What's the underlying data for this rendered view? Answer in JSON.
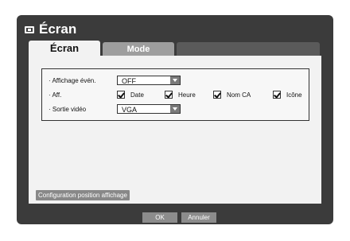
{
  "window": {
    "title": "Écran",
    "title_icon": "screen-icon"
  },
  "tabs": [
    {
      "label": "Écran",
      "active": true
    },
    {
      "label": "Mode",
      "active": false
    }
  ],
  "settings": {
    "event_display": {
      "label": "· Affichage évén.",
      "value": "OFF"
    },
    "display": {
      "label": "· Aff.",
      "options": [
        {
          "label": "Date",
          "checked": true
        },
        {
          "label": "Heure",
          "checked": true
        },
        {
          "label": "Nom CA",
          "checked": true
        },
        {
          "label": "Icône",
          "checked": true
        }
      ]
    },
    "video_output": {
      "label": "· Sortie vidéo",
      "value": "VGA"
    }
  },
  "buttons": {
    "config_position": "Configuration position affichage",
    "ok": "OK",
    "cancel": "Annuler"
  }
}
